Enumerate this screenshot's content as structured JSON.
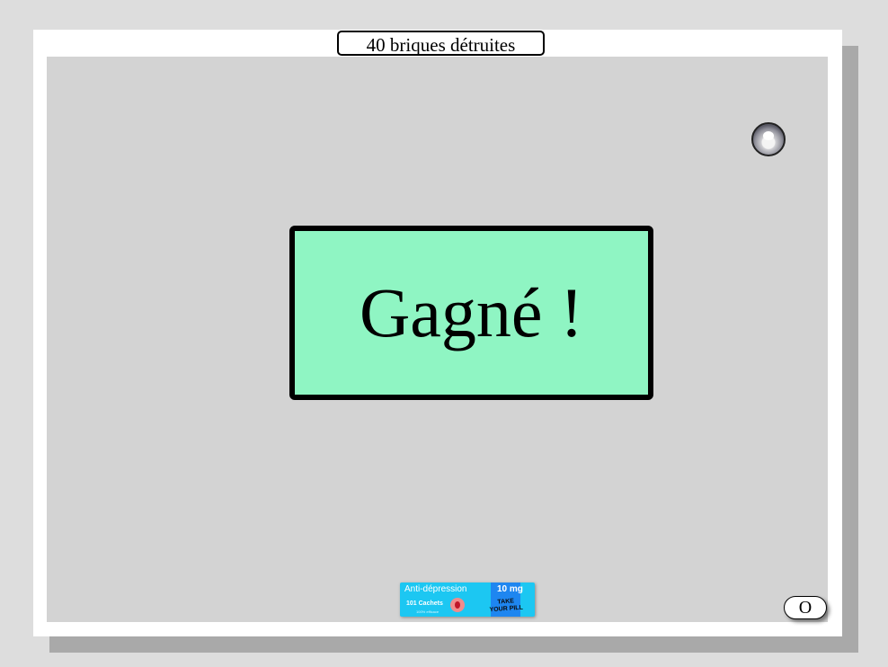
{
  "score": {
    "label": "40 briques détruites",
    "bricks_destroyed": 40
  },
  "message": {
    "text": "Gagné !",
    "background_color": "#8ff5c3"
  },
  "ball": {
    "icon": "cat-face-ball-icon"
  },
  "paddle": {
    "title": "Anti-dépression",
    "count": "101 Cachets",
    "sub": "100% efficace",
    "dose": "10 mg",
    "slogan": "TAKE YOUR PILL",
    "color": "#1cc7f2"
  },
  "corner_button": {
    "label": "O"
  },
  "colors": {
    "page_background": "#dddddd",
    "field_background": "#d3d3d3",
    "frame": "#ffffff"
  }
}
